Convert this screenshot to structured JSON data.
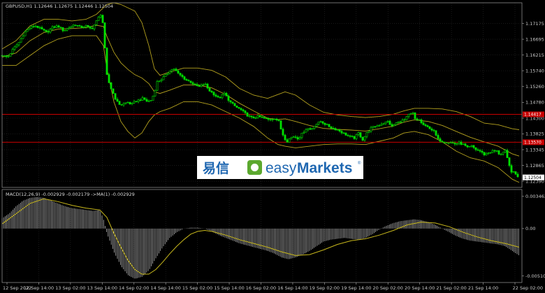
{
  "header": {
    "main_title": "GBPUSD,H1  1.12646 1.12675 1.12446 1.12504",
    "macd_title": "MACD(12,26,9) -0.002929 -0.002179 ->MA(1) -0.002929"
  },
  "logo": {
    "cn": "易信",
    "en_a": "easy",
    "en_b": "Markets",
    "reg": "®"
  },
  "price_axis": [
    "1.17175",
    "1.16695",
    "1.16215",
    "1.15740",
    "1.15260",
    "1.14780",
    "1.14300",
    "1.13825",
    "1.13345",
    "1.12865",
    "1.12390"
  ],
  "price_tags": [
    {
      "label": "1.14417",
      "price": 1.14417,
      "kind": "level"
    },
    {
      "label": "1.13570",
      "price": 1.1357,
      "kind": "level"
    },
    {
      "label": "1.12504",
      "price": 1.12504,
      "kind": "bid"
    }
  ],
  "macd_axis": [
    "0.003463",
    "0.00",
    "-0.005100"
  ],
  "time_axis": [
    "12 Sep 2022",
    "12 Sep 14:00",
    "13 Sep 02:00",
    "13 Sep 14:00",
    "14 Sep 02:00",
    "14 Sep 14:00",
    "15 Sep 02:00",
    "15 Sep 14:00",
    "16 Sep 02:00",
    "16 Sep 14:00",
    "19 Sep 02:00",
    "19 Sep 14:00",
    "20 Sep 02:00",
    "20 Sep 14:00",
    "21 Sep 02:00",
    "21 Sep 14:00",
    "22 Sep 02:00"
  ],
  "colors": {
    "background": "#000000",
    "grid": "#2a2a2a",
    "candle": "#00e000",
    "bollinger": "#b5a21e",
    "level_line": "#c80000",
    "macd_hist": "#d8d8d8",
    "signal": "#c8b81c",
    "axis_text": "#c8c8c8"
  },
  "chart_data": {
    "type": "candlestick",
    "symbol": "GBPUSD",
    "timeframe": "H1",
    "ylim": [
      1.122,
      1.178
    ],
    "close_path": [
      [
        0,
        1.162
      ],
      [
        8,
        1.1615
      ],
      [
        16,
        1.164
      ],
      [
        24,
        1.166
      ],
      [
        32,
        1.169
      ],
      [
        40,
        1.1705
      ],
      [
        48,
        1.171
      ],
      [
        56,
        1.17
      ],
      [
        64,
        1.169
      ],
      [
        72,
        1.1705
      ],
      [
        80,
        1.171
      ],
      [
        88,
        1.1695
      ],
      [
        96,
        1.1705
      ],
      [
        104,
        1.1715
      ],
      [
        112,
        1.1705
      ],
      [
        120,
        1.171
      ],
      [
        128,
        1.17
      ],
      [
        134,
        1.172
      ],
      [
        138,
        1.1735
      ],
      [
        141,
        1.1745
      ],
      [
        144,
        1.172
      ],
      [
        147,
        1.164
      ],
      [
        150,
        1.156
      ],
      [
        154,
        1.153
      ],
      [
        158,
        1.151
      ],
      [
        162,
        1.149
      ],
      [
        166,
        1.1475
      ],
      [
        170,
        1.147
      ],
      [
        175,
        1.1475
      ],
      [
        180,
        1.1478
      ],
      [
        185,
        1.1472
      ],
      [
        190,
        1.148
      ],
      [
        196,
        1.1485
      ],
      [
        202,
        1.149
      ],
      [
        208,
        1.148
      ],
      [
        214,
        1.1485
      ],
      [
        218,
        1.151
      ],
      [
        222,
        1.154
      ],
      [
        228,
        1.1548
      ],
      [
        234,
        1.156
      ],
      [
        240,
        1.1575
      ],
      [
        246,
        1.158
      ],
      [
        252,
        1.1565
      ],
      [
        258,
        1.1555
      ],
      [
        264,
        1.1545
      ],
      [
        270,
        1.154
      ],
      [
        276,
        1.153
      ],
      [
        282,
        1.1525
      ],
      [
        290,
        1.1535
      ],
      [
        296,
        1.1515
      ],
      [
        302,
        1.1505
      ],
      [
        310,
        1.149
      ],
      [
        318,
        1.1505
      ],
      [
        326,
        1.148
      ],
      [
        334,
        1.1465
      ],
      [
        342,
        1.1455
      ],
      [
        350,
        1.144
      ],
      [
        358,
        1.143
      ],
      [
        366,
        1.1435
      ],
      [
        374,
        1.143
      ],
      [
        382,
        1.1425
      ],
      [
        390,
        1.143
      ],
      [
        396,
        1.142
      ],
      [
        400,
        1.139
      ],
      [
        404,
        1.137
      ],
      [
        408,
        1.136
      ],
      [
        412,
        1.137
      ],
      [
        418,
        1.1375
      ],
      [
        424,
        1.1368
      ],
      [
        430,
        1.1385
      ],
      [
        436,
        1.14
      ],
      [
        442,
        1.1395
      ],
      [
        448,
        1.141
      ],
      [
        456,
        1.142
      ],
      [
        464,
        1.141
      ],
      [
        472,
        1.14
      ],
      [
        480,
        1.1395
      ],
      [
        488,
        1.1385
      ],
      [
        496,
        1.1375
      ],
      [
        504,
        1.137
      ],
      [
        510,
        1.1385
      ],
      [
        516,
        1.1365
      ],
      [
        522,
        1.1385
      ],
      [
        528,
        1.14
      ],
      [
        534,
        1.1405
      ],
      [
        540,
        1.141
      ],
      [
        546,
        1.1415
      ],
      [
        552,
        1.142
      ],
      [
        558,
        1.1405
      ],
      [
        564,
        1.1415
      ],
      [
        570,
        1.142
      ],
      [
        576,
        1.1425
      ],
      [
        582,
        1.144
      ],
      [
        588,
        1.1445
      ],
      [
        592,
        1.142
      ],
      [
        596,
        1.143
      ],
      [
        600,
        1.1415
      ],
      [
        606,
        1.1405
      ],
      [
        612,
        1.14
      ],
      [
        618,
        1.139
      ],
      [
        624,
        1.1365
      ],
      [
        630,
        1.136
      ],
      [
        636,
        1.1358
      ],
      [
        642,
        1.1356
      ],
      [
        648,
        1.1352
      ],
      [
        654,
        1.1355
      ],
      [
        660,
        1.135
      ],
      [
        666,
        1.134
      ],
      [
        672,
        1.1345
      ],
      [
        678,
        1.1335
      ],
      [
        684,
        1.133
      ],
      [
        690,
        1.132
      ],
      [
        696,
        1.1325
      ],
      [
        702,
        1.133
      ],
      [
        708,
        1.133
      ],
      [
        712,
        1.132
      ],
      [
        716,
        1.1325
      ],
      [
        720,
        1.133
      ],
      [
        724,
        1.13
      ],
      [
        728,
        1.127
      ],
      [
        732,
        1.1265
      ],
      [
        736,
        1.1258
      ],
      [
        740,
        1.125
      ]
    ],
    "bollinger_upper": [
      [
        0,
        1.164
      ],
      [
        20,
        1.1665
      ],
      [
        40,
        1.171
      ],
      [
        60,
        1.173
      ],
      [
        80,
        1.173
      ],
      [
        100,
        1.1725
      ],
      [
        120,
        1.173
      ],
      [
        135,
        1.1745
      ],
      [
        145,
        1.1765
      ],
      [
        150,
        1.1775
      ],
      [
        160,
        1.178
      ],
      [
        170,
        1.1775
      ],
      [
        180,
        1.1765
      ],
      [
        190,
        1.1755
      ],
      [
        200,
        1.172
      ],
      [
        210,
        1.165
      ],
      [
        218,
        1.158
      ],
      [
        226,
        1.156
      ],
      [
        240,
        1.157
      ],
      [
        260,
        1.1582
      ],
      [
        280,
        1.1582
      ],
      [
        300,
        1.1575
      ],
      [
        320,
        1.1555
      ],
      [
        340,
        1.152
      ],
      [
        360,
        1.15
      ],
      [
        380,
        1.149
      ],
      [
        395,
        1.1502
      ],
      [
        405,
        1.151
      ],
      [
        420,
        1.15
      ],
      [
        440,
        1.147
      ],
      [
        460,
        1.1448
      ],
      [
        480,
        1.144
      ],
      [
        500,
        1.1435
      ],
      [
        520,
        1.1432
      ],
      [
        540,
        1.1435
      ],
      [
        560,
        1.1442
      ],
      [
        575,
        1.1452
      ],
      [
        590,
        1.146
      ],
      [
        610,
        1.146
      ],
      [
        630,
        1.1458
      ],
      [
        650,
        1.145
      ],
      [
        670,
        1.1435
      ],
      [
        690,
        1.1415
      ],
      [
        710,
        1.141
      ],
      [
        730,
        1.1398
      ],
      [
        740,
        1.1395
      ]
    ],
    "bollinger_lower": [
      [
        0,
        1.159
      ],
      [
        20,
        1.159
      ],
      [
        40,
        1.162
      ],
      [
        60,
        1.165
      ],
      [
        80,
        1.167
      ],
      [
        100,
        1.168
      ],
      [
        120,
        1.168
      ],
      [
        135,
        1.168
      ],
      [
        145,
        1.165
      ],
      [
        150,
        1.158
      ],
      [
        160,
        1.148
      ],
      [
        170,
        1.142
      ],
      [
        180,
        1.139
      ],
      [
        190,
        1.137
      ],
      [
        200,
        1.1385
      ],
      [
        210,
        1.142
      ],
      [
        218,
        1.144
      ],
      [
        226,
        1.145
      ],
      [
        240,
        1.146
      ],
      [
        260,
        1.148
      ],
      [
        280,
        1.148
      ],
      [
        300,
        1.147
      ],
      [
        320,
        1.145
      ],
      [
        340,
        1.143
      ],
      [
        360,
        1.1405
      ],
      [
        380,
        1.137
      ],
      [
        395,
        1.135
      ],
      [
        405,
        1.1345
      ],
      [
        420,
        1.134
      ],
      [
        440,
        1.1345
      ],
      [
        460,
        1.135
      ],
      [
        480,
        1.1352
      ],
      [
        500,
        1.1352
      ],
      [
        520,
        1.135
      ],
      [
        540,
        1.136
      ],
      [
        560,
        1.137
      ],
      [
        575,
        1.1385
      ],
      [
        590,
        1.139
      ],
      [
        610,
        1.138
      ],
      [
        630,
        1.1358
      ],
      [
        650,
        1.133
      ],
      [
        670,
        1.131
      ],
      [
        690,
        1.13
      ],
      [
        710,
        1.128
      ],
      [
        730,
        1.1245
      ],
      [
        740,
        1.1235
      ]
    ],
    "bollinger_middle": [
      [
        0,
        1.1615
      ],
      [
        20,
        1.1628
      ],
      [
        40,
        1.1665
      ],
      [
        60,
        1.169
      ],
      [
        80,
        1.17
      ],
      [
        100,
        1.1702
      ],
      [
        120,
        1.1705
      ],
      [
        135,
        1.1712
      ],
      [
        145,
        1.1708
      ],
      [
        150,
        1.1678
      ],
      [
        160,
        1.163
      ],
      [
        170,
        1.1598
      ],
      [
        180,
        1.1578
      ],
      [
        190,
        1.1562
      ],
      [
        200,
        1.1552
      ],
      [
        210,
        1.1535
      ],
      [
        218,
        1.151
      ],
      [
        226,
        1.1505
      ],
      [
        240,
        1.1515
      ],
      [
        260,
        1.1531
      ],
      [
        280,
        1.1531
      ],
      [
        300,
        1.1522
      ],
      [
        320,
        1.1502
      ],
      [
        340,
        1.1475
      ],
      [
        360,
        1.1452
      ],
      [
        380,
        1.143
      ],
      [
        395,
        1.1426
      ],
      [
        405,
        1.1428
      ],
      [
        420,
        1.142
      ],
      [
        440,
        1.1408
      ],
      [
        460,
        1.1399
      ],
      [
        480,
        1.1396
      ],
      [
        500,
        1.1394
      ],
      [
        520,
        1.1391
      ],
      [
        540,
        1.1398
      ],
      [
        560,
        1.1406
      ],
      [
        575,
        1.1418
      ],
      [
        590,
        1.1425
      ],
      [
        610,
        1.142
      ],
      [
        630,
        1.1408
      ],
      [
        650,
        1.139
      ],
      [
        670,
        1.1372
      ],
      [
        690,
        1.1358
      ],
      [
        710,
        1.1345
      ],
      [
        730,
        1.1322
      ],
      [
        740,
        1.1315
      ]
    ],
    "macd_ylim": [
      -0.0058,
      0.0042
    ],
    "macd_hist": [
      [
        0,
        0.0011
      ],
      [
        10,
        0.0016
      ],
      [
        20,
        0.0024
      ],
      [
        30,
        0.003
      ],
      [
        40,
        0.0033
      ],
      [
        50,
        0.0034
      ],
      [
        60,
        0.0033
      ],
      [
        70,
        0.003
      ],
      [
        80,
        0.0027
      ],
      [
        90,
        0.0024
      ],
      [
        100,
        0.0022
      ],
      [
        110,
        0.0021
      ],
      [
        120,
        0.002
      ],
      [
        130,
        0.0019
      ],
      [
        140,
        0.002
      ],
      [
        145,
        0.001
      ],
      [
        150,
        -0.0005
      ],
      [
        160,
        -0.0025
      ],
      [
        170,
        -0.004
      ],
      [
        180,
        -0.005
      ],
      [
        190,
        -0.0054
      ],
      [
        200,
        -0.0052
      ],
      [
        210,
        -0.0045
      ],
      [
        220,
        -0.0032
      ],
      [
        230,
        -0.002
      ],
      [
        240,
        -0.001
      ],
      [
        250,
        -0.0004
      ],
      [
        260,
        0.0
      ],
      [
        270,
        0.0001
      ],
      [
        280,
        0.0001
      ],
      [
        290,
        0.0
      ],
      [
        300,
        -0.0003
      ],
      [
        310,
        -0.0007
      ],
      [
        320,
        -0.001
      ],
      [
        330,
        -0.0013
      ],
      [
        340,
        -0.0016
      ],
      [
        350,
        -0.0018
      ],
      [
        360,
        -0.002
      ],
      [
        370,
        -0.0022
      ],
      [
        380,
        -0.0024
      ],
      [
        390,
        -0.0027
      ],
      [
        400,
        -0.0031
      ],
      [
        410,
        -0.0033
      ],
      [
        420,
        -0.0031
      ],
      [
        430,
        -0.0028
      ],
      [
        440,
        -0.0024
      ],
      [
        450,
        -0.0019
      ],
      [
        460,
        -0.0014
      ],
      [
        470,
        -0.0012
      ],
      [
        480,
        -0.0011
      ],
      [
        490,
        -0.001
      ],
      [
        500,
        -0.0011
      ],
      [
        510,
        -0.0012
      ],
      [
        520,
        -0.001
      ],
      [
        530,
        -0.0006
      ],
      [
        540,
        -0.0001
      ],
      [
        550,
        0.0003
      ],
      [
        560,
        0.0006
      ],
      [
        570,
        0.0008
      ],
      [
        580,
        0.0009
      ],
      [
        590,
        0.001
      ],
      [
        600,
        0.0009
      ],
      [
        610,
        0.0007
      ],
      [
        620,
        0.0004
      ],
      [
        630,
        0.0
      ],
      [
        640,
        -0.0004
      ],
      [
        650,
        -0.0008
      ],
      [
        660,
        -0.0011
      ],
      [
        670,
        -0.0013
      ],
      [
        680,
        -0.0014
      ],
      [
        690,
        -0.0015
      ],
      [
        700,
        -0.0016
      ],
      [
        710,
        -0.0017
      ],
      [
        720,
        -0.0019
      ],
      [
        730,
        -0.0024
      ],
      [
        740,
        -0.0029
      ]
    ],
    "macd_signal": [
      [
        0,
        0.0005
      ],
      [
        20,
        0.0016
      ],
      [
        40,
        0.0027
      ],
      [
        60,
        0.0032
      ],
      [
        80,
        0.0029
      ],
      [
        100,
        0.0025
      ],
      [
        120,
        0.0022
      ],
      [
        140,
        0.002
      ],
      [
        150,
        0.0012
      ],
      [
        160,
        -0.0005
      ],
      [
        170,
        -0.002
      ],
      [
        180,
        -0.0034
      ],
      [
        190,
        -0.0044
      ],
      [
        200,
        -0.0049
      ],
      [
        210,
        -0.0049
      ],
      [
        220,
        -0.0044
      ],
      [
        230,
        -0.0036
      ],
      [
        240,
        -0.0027
      ],
      [
        250,
        -0.0019
      ],
      [
        260,
        -0.0012
      ],
      [
        270,
        -0.0006
      ],
      [
        280,
        -0.0003
      ],
      [
        290,
        -0.0002
      ],
      [
        300,
        -0.0003
      ],
      [
        320,
        -0.0007
      ],
      [
        340,
        -0.0012
      ],
      [
        360,
        -0.0016
      ],
      [
        380,
        -0.002
      ],
      [
        400,
        -0.0025
      ],
      [
        420,
        -0.0029
      ],
      [
        440,
        -0.0028
      ],
      [
        460,
        -0.0023
      ],
      [
        480,
        -0.0017
      ],
      [
        500,
        -0.0013
      ],
      [
        520,
        -0.0011
      ],
      [
        540,
        -0.0007
      ],
      [
        560,
        -0.0002
      ],
      [
        580,
        0.0004
      ],
      [
        600,
        0.0007
      ],
      [
        620,
        0.0006
      ],
      [
        640,
        0.0002
      ],
      [
        660,
        -0.0004
      ],
      [
        680,
        -0.0009
      ],
      [
        700,
        -0.0013
      ],
      [
        720,
        -0.0016
      ],
      [
        740,
        -0.002
      ]
    ]
  }
}
